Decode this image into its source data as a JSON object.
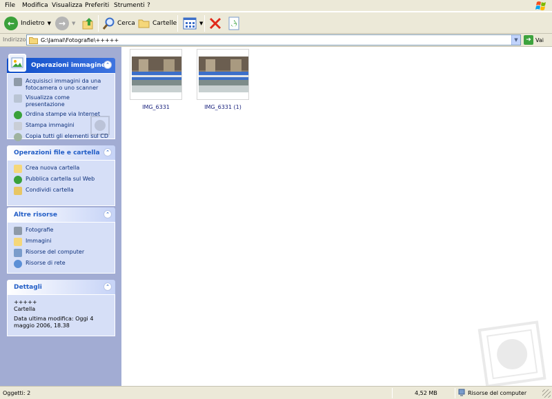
{
  "menu": [
    "File",
    "Modifica",
    "Visualizza",
    "Preferiti",
    "Strumenti",
    "?"
  ],
  "toolbar": {
    "back_label": "Indietro",
    "search_label": "Cerca",
    "folders_label": "Cartelle"
  },
  "address": {
    "label": "Indirizzo",
    "value": "G:\\Jamal\\Fotografie\\+++++",
    "go_label": "Vai"
  },
  "panels": {
    "image_tasks": {
      "title": "Operazioni immagine",
      "items": [
        "Acquisisci immagini da una fotocamera o uno scanner",
        "Visualizza come presentazione",
        "Ordina stampe via Internet",
        "Stampa immagini",
        "Copia tutti gli elementi sul CD"
      ]
    },
    "file_tasks": {
      "title": "Operazioni file e cartella",
      "items": [
        "Crea nuova cartella",
        "Pubblica cartella sul Web",
        "Condividi cartella"
      ]
    },
    "other_places": {
      "title": "Altre risorse",
      "items": [
        "Fotografie",
        "Immagini",
        "Risorse del computer",
        "Risorse di rete"
      ]
    },
    "details": {
      "title": "Dettagli",
      "name": "+++++",
      "type": "Cartella",
      "modified": "Data ultima modifica: Oggi 4 maggio 2006, 18.38"
    }
  },
  "files": [
    {
      "name": "IMG_6331"
    },
    {
      "name": "IMG_6331 (1)"
    }
  ],
  "status": {
    "objects": "Oggetti: 2",
    "size": "4,52 MB",
    "location": "Risorse del computer"
  }
}
